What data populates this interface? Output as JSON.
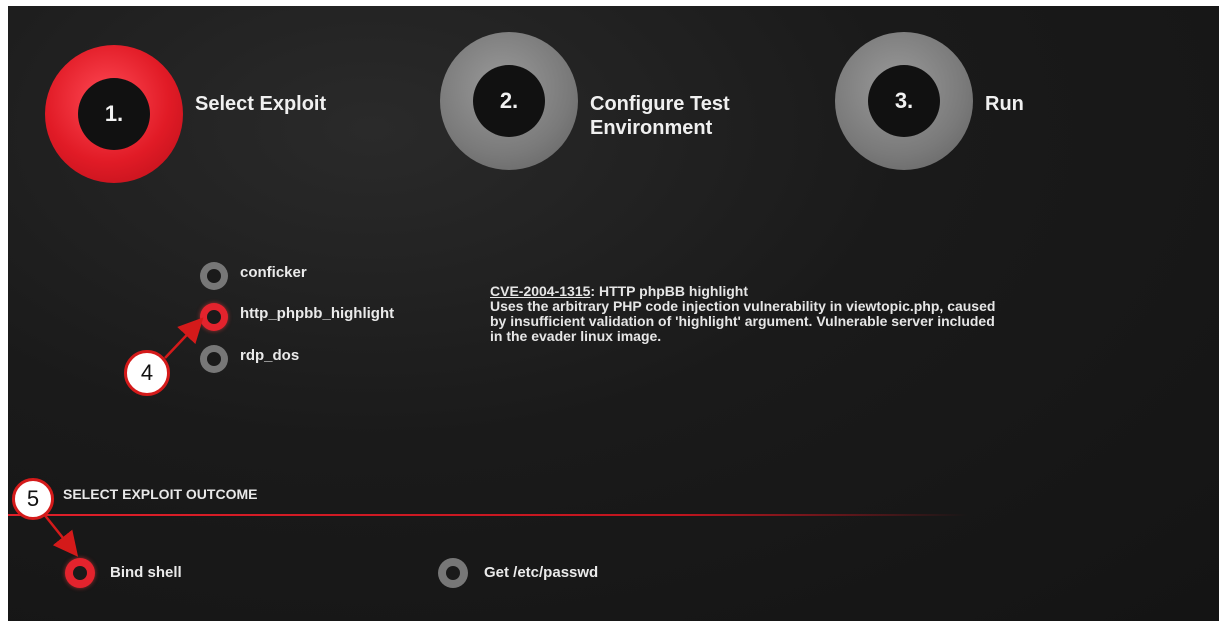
{
  "steps": [
    {
      "number": "1.",
      "label": "Select Exploit",
      "state": "active"
    },
    {
      "number": "2.",
      "label": "Configure Test\nEnvironment",
      "state": "inactive"
    },
    {
      "number": "3.",
      "label": "Run",
      "state": "inactive"
    }
  ],
  "exploits": [
    {
      "label": "conficker",
      "selected": false
    },
    {
      "label": "http_phpbb_highlight",
      "selected": true
    },
    {
      "label": "rdp_dos",
      "selected": false
    }
  ],
  "description": {
    "cve": "CVE-2004-1315",
    "title": ": HTTP phpBB highlight",
    "body": "Uses the arbitrary PHP code injection vulnerability in viewtopic.php, caused by insufficient validation of 'highlight' argument. Vulnerable server included in the evader linux image."
  },
  "outcome": {
    "title": "SELECT EXPLOIT OUTCOME",
    "options": [
      {
        "label": "Bind shell",
        "selected": true
      },
      {
        "label": "Get /etc/passwd",
        "selected": false
      }
    ]
  },
  "callouts": {
    "four": "4",
    "five": "5"
  },
  "colors": {
    "accent": "#e3232d",
    "inactive": "#7a7a7a",
    "background": "#1a1a1a"
  }
}
